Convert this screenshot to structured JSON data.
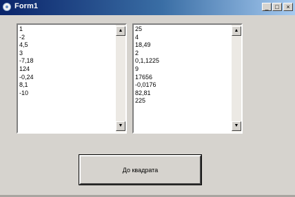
{
  "window": {
    "title": "Form1",
    "controls": {
      "minimize": "_",
      "maximize": "□",
      "close": "×"
    }
  },
  "lists": {
    "left": {
      "items": [
        "1",
        "-2",
        "4,5",
        "3",
        "-7,18",
        "124",
        "-0,24",
        "8,1",
        "-10"
      ]
    },
    "right": {
      "items": [
        "25",
        "4",
        "18,49",
        "2",
        "0,1,1225",
        "9",
        "17656",
        "-0,0176",
        "82,81",
        "225"
      ]
    }
  },
  "scroll_glyphs": {
    "up": "▲",
    "down": "▼"
  },
  "button": {
    "label": "До квадрата"
  }
}
